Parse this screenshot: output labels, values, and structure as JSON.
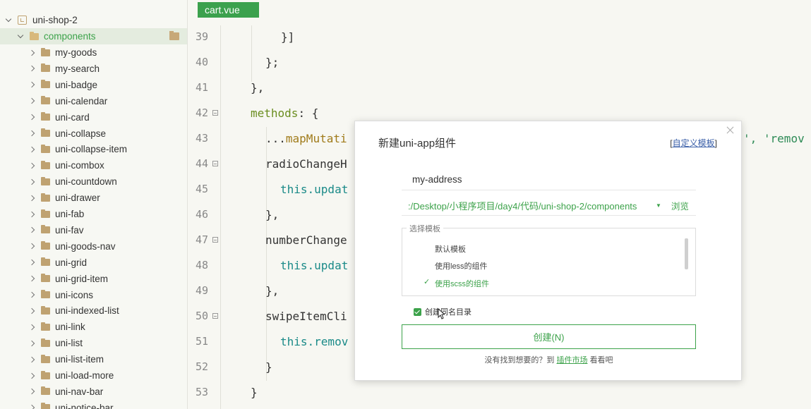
{
  "sidebar": {
    "project": "uni-shop-2",
    "folder": "components",
    "items": [
      "my-goods",
      "my-search",
      "uni-badge",
      "uni-calendar",
      "uni-card",
      "uni-collapse",
      "uni-collapse-item",
      "uni-combox",
      "uni-countdown",
      "uni-drawer",
      "uni-fab",
      "uni-fav",
      "uni-goods-nav",
      "uni-grid",
      "uni-grid-item",
      "uni-icons",
      "uni-indexed-list",
      "uni-link",
      "uni-list",
      "uni-list-item",
      "uni-load-more",
      "uni-nav-bar",
      "uni-notice-bar"
    ]
  },
  "editor": {
    "tab": "cart.vue",
    "line_numbers": [
      "39",
      "40",
      "41",
      "42",
      "43",
      "44",
      "45",
      "46",
      "47",
      "48",
      "49",
      "50",
      "51",
      "52",
      "53"
    ],
    "code": {
      "l39": "}]",
      "l40": "};",
      "l41": "},",
      "l42_kw": "methods",
      "l42_rest": ": {",
      "l43_spread": "...",
      "l43_fn": "mapMutati",
      "l43_tail1": "', ",
      "l43_tail2": "'remov",
      "l44": "radioChangeH",
      "l45_this": "this",
      "l45_rest": ".updat",
      "l46": "},",
      "l47": "numberChange",
      "l48_this": "this",
      "l48_rest": ".updat",
      "l49": "},",
      "l50": "swipeItemCli",
      "l51_this": "this",
      "l51_rest": ".remov",
      "l52": "}",
      "l53": "}"
    }
  },
  "dialog": {
    "title": "新建uni-app组件",
    "custom_template_link": "自定义模板",
    "name_value": "my-address",
    "path": ":/Desktop/小程序项目/day4/代码/uni-shop-2/components",
    "browse": "浏览",
    "template_legend": "选择模板",
    "templates": [
      "默认模板",
      "使用less的组件",
      "使用scss的组件"
    ],
    "create_same_dir": "创建同名目录",
    "create_button": "创建(N)",
    "footer_prefix": "没有找到想要的？到",
    "footer_link": "插件市场",
    "footer_suffix": "看看吧"
  }
}
